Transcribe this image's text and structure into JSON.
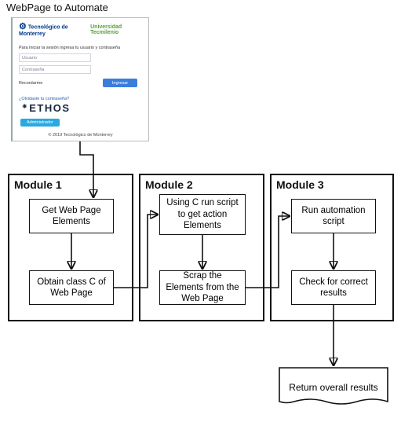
{
  "title": "WebPage to Automate",
  "webpanel": {
    "logo1": "Tecnológico de Monterrey",
    "logo2": "Universidad Tecmilenio",
    "hint": "Para iniciar la sesión ingresa tu usuario y contraseña",
    "user_placeholder": "Usuario",
    "pass_placeholder": "Contraseña",
    "forgot": "Recordarme",
    "login_btn": "Ingresar",
    "tiny_link": "¿Olvidaste tu contraseña?",
    "ethos": "ETHOS",
    "pill": "Administrador",
    "copy": "© 2019 Tecnológico de Monterrey"
  },
  "modules": {
    "m1": {
      "label": "Module 1",
      "n1": "Get Web Page Elements",
      "n2": "Obtain class C of Web Page"
    },
    "m2": {
      "label": "Module 2",
      "n1": "Using C run script to get action Elements",
      "n2": "Scrap the Elements from the Web Page"
    },
    "m3": {
      "label": "Module 3",
      "n1": "Run automation script",
      "n2": "Check for correct results"
    }
  },
  "result": "Return overall results"
}
